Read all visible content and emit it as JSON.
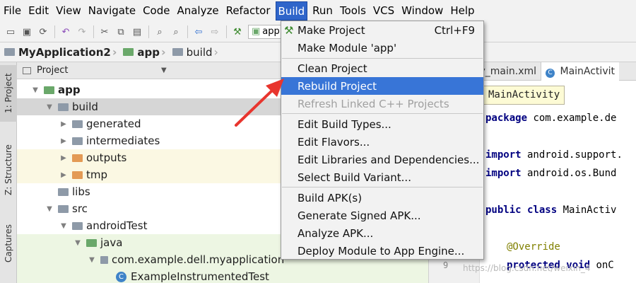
{
  "menubar": [
    "File",
    "Edit",
    "View",
    "Navigate",
    "Code",
    "Analyze",
    "Refactor",
    "Build",
    "Run",
    "Tools",
    "VCS",
    "Window",
    "Help"
  ],
  "toolbar": {
    "config_label": "app"
  },
  "breadcrumb": [
    "MyApplication2",
    "app",
    "build"
  ],
  "side_tabs": [
    "1: Project",
    "Z: Structure",
    "Captures"
  ],
  "project_panel": {
    "header": "Project",
    "tree": [
      {
        "label": "app",
        "bold": true
      },
      {
        "label": "build"
      },
      {
        "label": "generated"
      },
      {
        "label": "intermediates"
      },
      {
        "label": "outputs"
      },
      {
        "label": "tmp"
      },
      {
        "label": "libs"
      },
      {
        "label": "src"
      },
      {
        "label": "androidTest"
      },
      {
        "label": "java"
      },
      {
        "label": "com.example.dell.myapplication"
      },
      {
        "label": "ExampleInstrumentedTest"
      }
    ]
  },
  "editor": {
    "tabs": [
      "ty_main.xml",
      "MainActivit"
    ],
    "tooltip": "MainActivity",
    "lines": {
      "l1_kw": "package",
      "l1_rest": " com.example.de",
      "l2_kw": "import",
      "l2_rest": " android.support.",
      "l3_kw": "import",
      "l3_rest": " android.os.Bund",
      "l4_kw1": "public",
      "l4_kw2": " class",
      "l4_rest": " MainActiv",
      "l5": "@Override",
      "l6_kw1": "protected",
      "l6_kw2": " void",
      "l6_rest": " onC"
    },
    "line_number": "9"
  },
  "build_menu": {
    "items": [
      {
        "label": "Make Project",
        "shortcut": "Ctrl+F9"
      },
      {
        "label": "Make Module 'app'"
      },
      {
        "label": "Clean Project"
      },
      {
        "label": "Rebuild Project"
      },
      {
        "label": "Refresh Linked C++ Projects"
      },
      {
        "label": "Edit Build Types..."
      },
      {
        "label": "Edit Flavors..."
      },
      {
        "label": "Edit Libraries and Dependencies..."
      },
      {
        "label": "Select Build Variant..."
      },
      {
        "label": "Build APK(s)"
      },
      {
        "label": "Generate Signed APK..."
      },
      {
        "label": "Analyze APK..."
      },
      {
        "label": "Deploy Module to App Engine..."
      }
    ]
  },
  "watermark": "https://blog.csdn.net/weixin_4"
}
